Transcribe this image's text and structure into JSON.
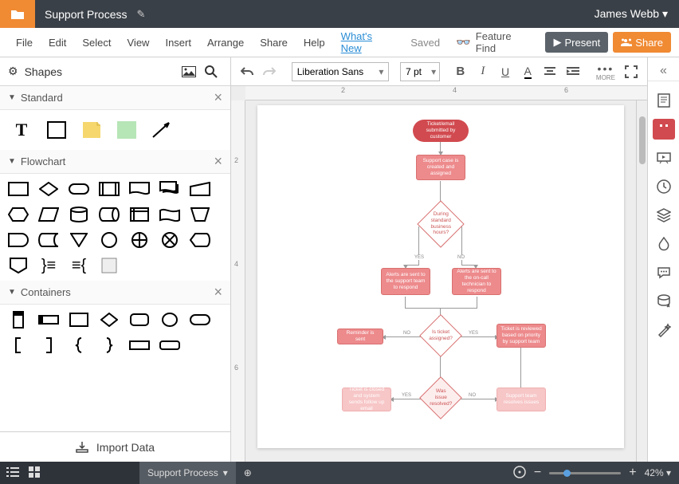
{
  "titlebar": {
    "doc_title": "Support Process",
    "user": "James Webb"
  },
  "menubar": {
    "items": [
      "File",
      "Edit",
      "Select",
      "View",
      "Insert",
      "Arrange",
      "Share",
      "Help"
    ],
    "whats_new": "What's New",
    "saved": "Saved",
    "feature_find": "Feature Find",
    "present": "Present",
    "share": "Share"
  },
  "shapes_panel": {
    "title": "Shapes",
    "sections": {
      "standard": "Standard",
      "flowchart": "Flowchart",
      "containers": "Containers"
    },
    "import_data": "Import Data"
  },
  "toolbar": {
    "font": "Liberation Sans",
    "font_size": "7 pt",
    "more_label": "MORE"
  },
  "canvas": {
    "ruler_ticks_h": [
      "2",
      "4",
      "6"
    ],
    "ruler_ticks_v": [
      "2",
      "4",
      "6"
    ],
    "nodes": {
      "start": "Ticket/email submitted by customer",
      "create": "Support case is created and assigned",
      "hours": "During standard business hours?",
      "alert_team": "Alerts are sent to the support team to respond",
      "alert_oncall": "Alerts are sent to the on-call technician to respond",
      "reminder": "Reminder is sent",
      "assigned": "Is ticket assigned?",
      "review": "Ticket is reviewed based on priority by support team",
      "closed": "Ticket is closed and system sends follow up email",
      "resolved": "Was issue resolved?",
      "resolves": "Support team resolves issues"
    },
    "edge_labels": {
      "yes": "YES",
      "no": "NO"
    }
  },
  "statusbar": {
    "tab": "Support Process",
    "zoom": "42%"
  }
}
